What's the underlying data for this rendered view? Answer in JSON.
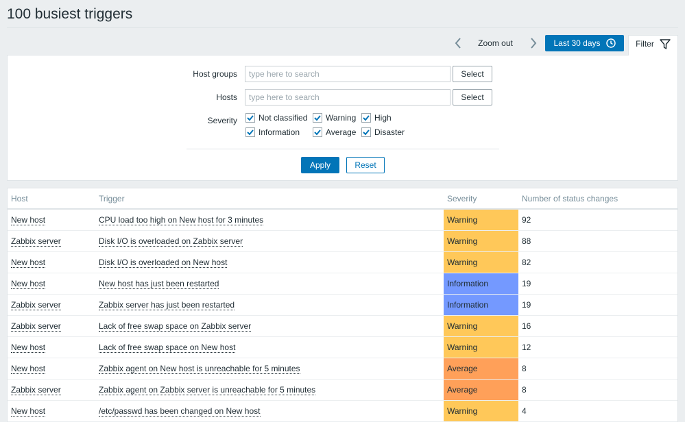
{
  "page": {
    "title": "100 busiest triggers"
  },
  "timebar": {
    "zoom_out": "Zoom out",
    "period": "Last 30 days",
    "filter_tab": "Filter"
  },
  "filter": {
    "host_groups_label": "Host groups",
    "host_groups_placeholder": "type here to search",
    "hosts_label": "Hosts",
    "hosts_placeholder": "type here to search",
    "select_label": "Select",
    "severity_label": "Severity",
    "severities": [
      {
        "label": "Not classified",
        "checked": true
      },
      {
        "label": "Warning",
        "checked": true
      },
      {
        "label": "High",
        "checked": true
      },
      {
        "label": "Information",
        "checked": true
      },
      {
        "label": "Average",
        "checked": true
      },
      {
        "label": "Disaster",
        "checked": true
      }
    ],
    "apply_label": "Apply",
    "reset_label": "Reset"
  },
  "table": {
    "headers": [
      "Host",
      "Trigger",
      "Severity",
      "Number of status changes"
    ],
    "severity_colors": {
      "Warning": "#ffc859",
      "Information": "#7499ff",
      "Average": "#ffa059"
    },
    "rows": [
      {
        "host": "New host",
        "trigger": "CPU load too high on New host for 3 minutes",
        "severity": "Warning",
        "changes": "92"
      },
      {
        "host": "Zabbix server",
        "trigger": "Disk I/O is overloaded on Zabbix server",
        "severity": "Warning",
        "changes": "88"
      },
      {
        "host": "New host",
        "trigger": "Disk I/O is overloaded on New host",
        "severity": "Warning",
        "changes": "82"
      },
      {
        "host": "New host",
        "trigger": "New host has just been restarted",
        "severity": "Information",
        "changes": "19"
      },
      {
        "host": "Zabbix server",
        "trigger": "Zabbix server has just been restarted",
        "severity": "Information",
        "changes": "19"
      },
      {
        "host": "Zabbix server",
        "trigger": "Lack of free swap space on Zabbix server",
        "severity": "Warning",
        "changes": "16"
      },
      {
        "host": "New host",
        "trigger": "Lack of free swap space on New host",
        "severity": "Warning",
        "changes": "12"
      },
      {
        "host": "New host",
        "trigger": "Zabbix agent on New host is unreachable for 5 minutes",
        "severity": "Average",
        "changes": "8"
      },
      {
        "host": "Zabbix server",
        "trigger": "Zabbix agent on Zabbix server is unreachable for 5 minutes",
        "severity": "Average",
        "changes": "8"
      },
      {
        "host": "New host",
        "trigger": "/etc/passwd has been changed on New host",
        "severity": "Warning",
        "changes": "4"
      }
    ]
  }
}
